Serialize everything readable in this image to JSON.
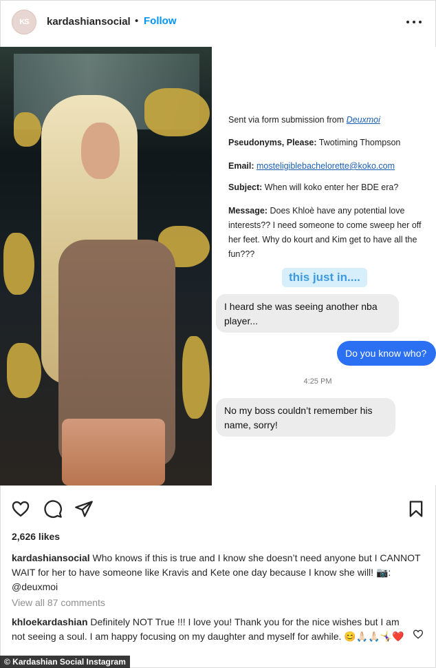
{
  "header": {
    "avatar_text": "KS",
    "username": "kardashiansocial",
    "dot": "•",
    "follow_label": "Follow",
    "more_icon": "more-options-icon"
  },
  "post_screenshot": {
    "form_intro": "Sent via form submission from ",
    "form_source": "Deuxmoi",
    "pseudonym_label": "Pseudonyms, Please:",
    "pseudonym_value": "Twotiming Thompson",
    "email_label": "Email:",
    "email_value": "mosteligiblebachelorette@koko.com",
    "subject_label": "Subject:",
    "subject_value": "When will koko enter her BDE era?",
    "message_label": "Message:",
    "message_value": "Does Khloè have any potential love interests?? I need someone to come sweep her off her feet. Why do kourt and Kim get to have all the fun???",
    "highlight": "this just in....",
    "msg1": "I heard she was seeing another nba player...",
    "msg2": "Do you know who?",
    "timestamp": "4:25 PM",
    "msg3": "No my boss couldn’t remember his name, sorry!"
  },
  "actions": {
    "like_icon": "heart-icon",
    "comment_icon": "comment-icon",
    "share_icon": "share-icon",
    "save_icon": "bookmark-icon"
  },
  "likes": "2,626 likes",
  "caption": {
    "user": "kardashiansocial",
    "text": "Who knows if this is true and I know she doesn’t need anyone but I CANNOT WAIT for her to have someone like Kravis and Kete one day because I know she will! 📷: @deuxmoi"
  },
  "view_all_comments": "View all 87 comments",
  "reply": {
    "user": "khloekardashian",
    "text": "Definitely NOT True !!! I love you! Thank you for the nice wishes but I am not seeing a soul. I am happy focusing on my daughter and myself for awhile. 😊🙏🏻🙏🏻🤸‍♀️❤️"
  },
  "credit": "© Kardashian Social Instagram"
}
